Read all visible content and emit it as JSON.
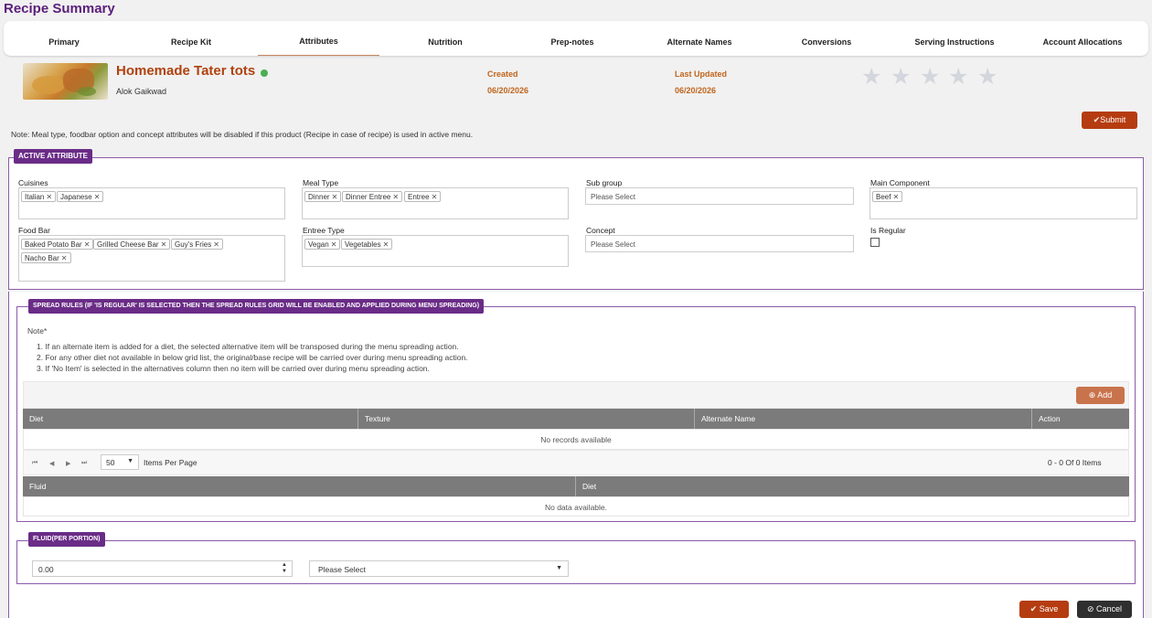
{
  "page": {
    "title": "Recipe Summary"
  },
  "tabs": [
    {
      "label": "Primary"
    },
    {
      "label": "Recipe Kit"
    },
    {
      "label": "Attributes"
    },
    {
      "label": "Nutrition"
    },
    {
      "label": "Prep-notes"
    },
    {
      "label": "Alternate Names"
    },
    {
      "label": "Conversions"
    },
    {
      "label": "Serving Instructions"
    },
    {
      "label": "Account Allocations"
    }
  ],
  "active_tab": "Attributes",
  "recipe": {
    "name": "Homemade Tater tots",
    "author": "Alok Gaikwad",
    "status_color": "#4caf50",
    "created_label": "Created",
    "created_value": "06/20/2026",
    "updated_label": "Last Updated",
    "updated_value": "06/20/2026",
    "rating": 0,
    "rating_max": 5
  },
  "actions": {
    "submit_label": "Submit",
    "save_label": "Save",
    "cancel_label": "Cancel",
    "add_label": "Add"
  },
  "note": "Note: Meal type, foodbar option and concept attributes will be disabled if this product (Recipe in case of recipe) is used in active menu.",
  "active_attribute": {
    "legend": "ACTIVE ATTRIBUTE",
    "cuisines": {
      "label": "Cuisines",
      "values": [
        "Italian",
        "Japanese"
      ]
    },
    "meal_type": {
      "label": "Meal Type",
      "values": [
        "Dinner",
        "Dinner Entree",
        "Entree"
      ]
    },
    "sub_group": {
      "label": "Sub group",
      "placeholder": "Please Select"
    },
    "main_component": {
      "label": "Main Component",
      "values": [
        "Beef"
      ]
    },
    "food_bar": {
      "label": "Food Bar",
      "values": [
        "Baked Potato Bar",
        "Grilled Cheese Bar",
        "Guy's Fries",
        "Nacho Bar"
      ]
    },
    "entree_type": {
      "label": "Entree Type",
      "values": [
        "Vegan",
        "Vegetables"
      ]
    },
    "concept": {
      "label": "Concept",
      "placeholder": "Please Select"
    },
    "is_regular": {
      "label": "Is Regular",
      "checked": false
    }
  },
  "spread_rules": {
    "legend": "SPREAD RULES (IF 'IS REGULAR' IS SELECTED THEN THE SPREAD RULES GRID WILL BE ENABLED AND APPLIED DURING MENU SPREADING)",
    "note_title": "Note*",
    "notes": [
      "1. If an alternate item is added for a diet, the selected alternative item will be transposed during the menu spreading action.",
      "2. For any other diet not available in below grid list, the original/base recipe will be carried over during menu spreading action.",
      "3. If 'No Item' is selected in the alternatives column then no item will be carried over during menu spreading action."
    ],
    "grid_columns": [
      "Diet",
      "Texture",
      "Alternate Name",
      "Action"
    ],
    "grid_empty": "No records available",
    "page_size": "50",
    "items_per_page_label": "Items Per Page",
    "pager_summary": "0 - 0 Of 0 Items",
    "fluid_columns": [
      "Fluid",
      "Diet"
    ],
    "fluid_empty": "No data available."
  },
  "fluid": {
    "legend": "FLUID(PER PORTION)",
    "amount": "0.00",
    "unit_placeholder": "Please Select"
  },
  "colors": {
    "brand_purple": "#6a2c87",
    "accent_orange": "#b53c10",
    "header_grey": "#7b7b7b"
  }
}
